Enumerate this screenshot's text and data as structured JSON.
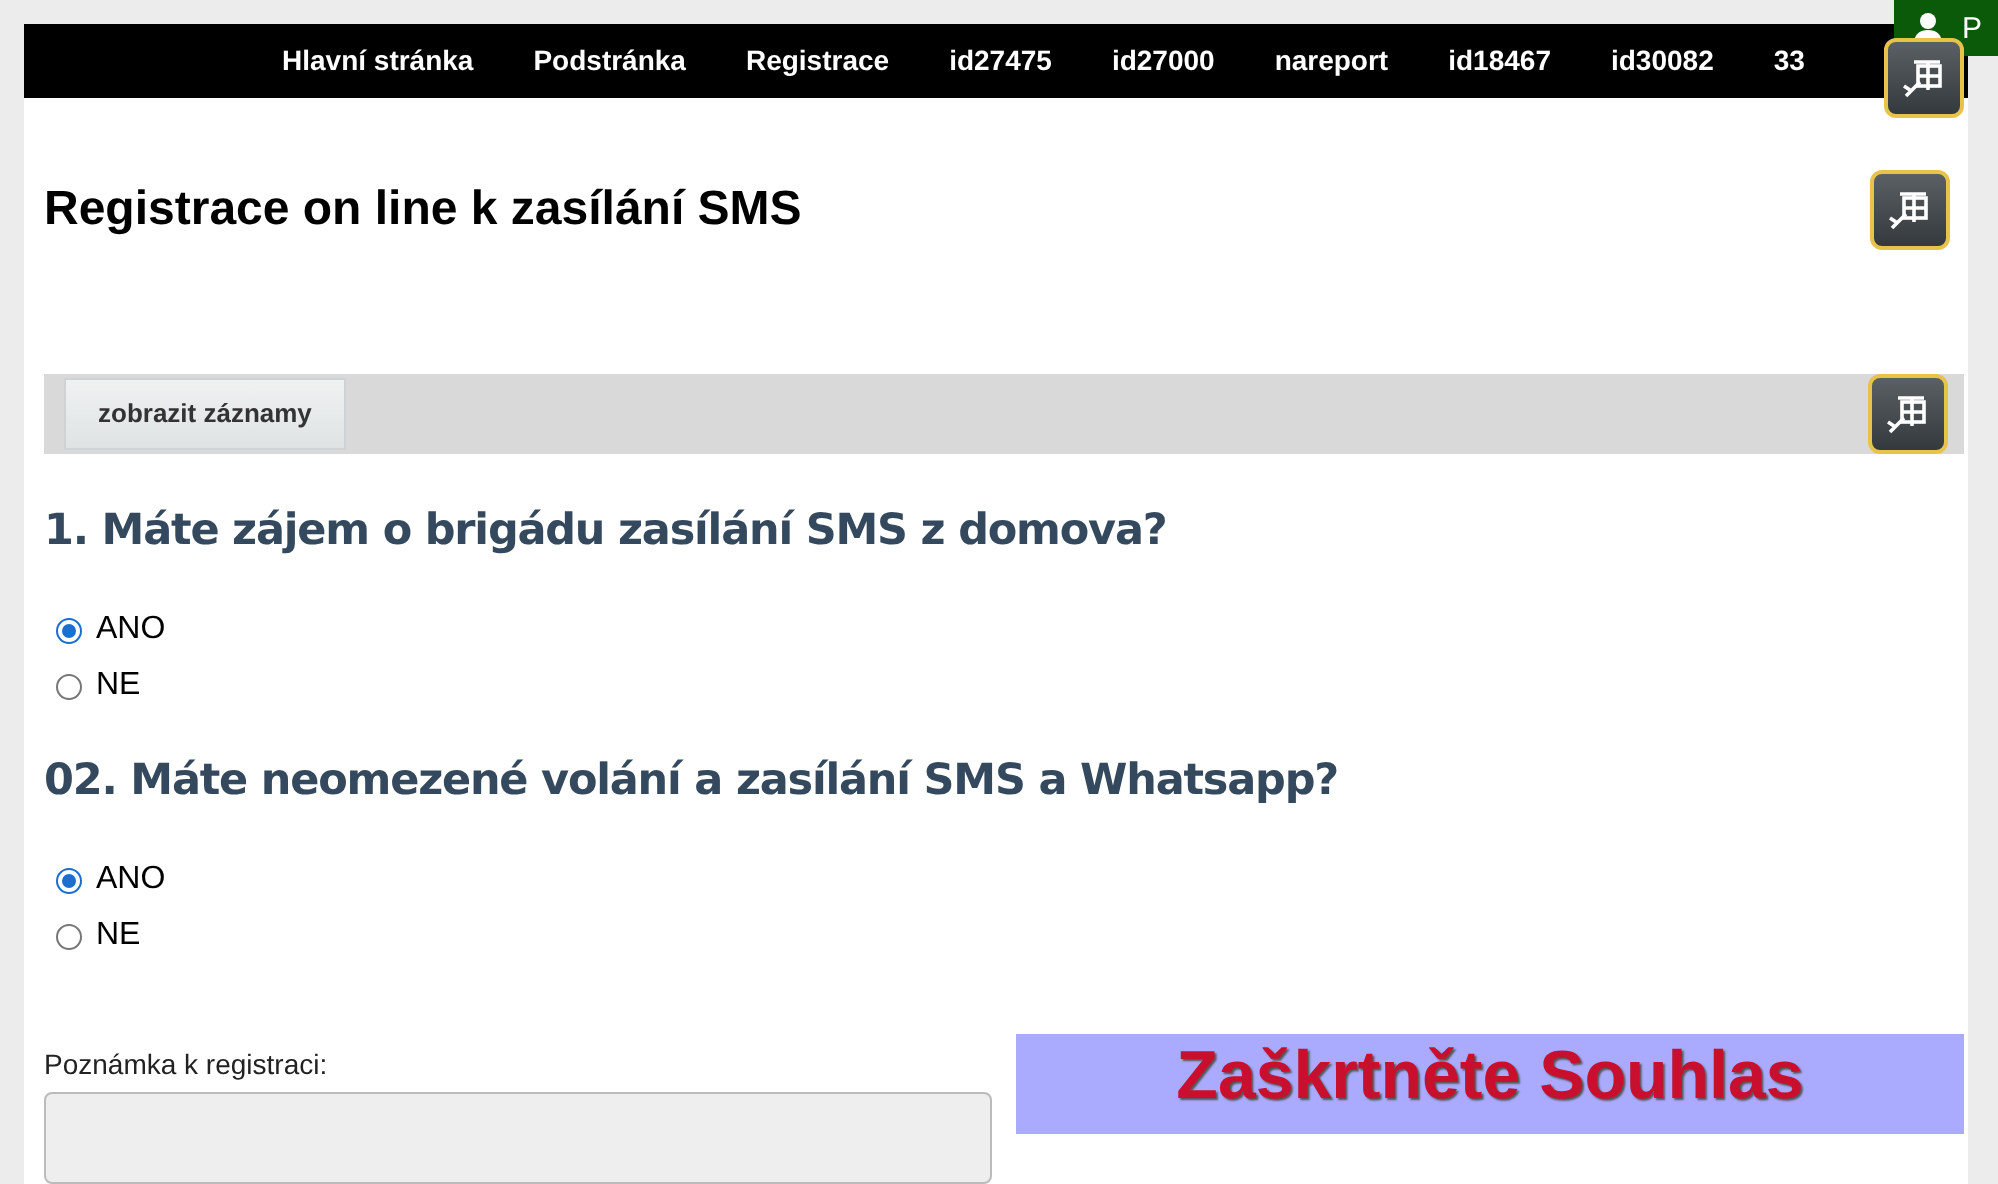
{
  "nav": {
    "items": [
      {
        "label": "Hlavní stránka"
      },
      {
        "label": "Podstránka"
      },
      {
        "label": "Registrace"
      },
      {
        "label": "id27475"
      },
      {
        "label": "id27000"
      },
      {
        "label": "nareport"
      },
      {
        "label": "id18467"
      },
      {
        "label": "id30082"
      },
      {
        "label": "33"
      }
    ]
  },
  "user_badge": {
    "label": "P"
  },
  "page_title": "Registrace on line k zasílání SMS",
  "toolbar": {
    "button": "zobrazit záznamy"
  },
  "questions": [
    {
      "title": "1. Máte zájem o brigádu zasílání SMS z domova?",
      "options": [
        {
          "label": "ANO",
          "selected": true
        },
        {
          "label": "NE",
          "selected": false
        }
      ]
    },
    {
      "title": "02. Máte neomezené volání a zasílání SMS a Whatsapp?",
      "options": [
        {
          "label": "ANO",
          "selected": true
        },
        {
          "label": "NE",
          "selected": false
        }
      ]
    }
  ],
  "note": {
    "label": "Poznámka k registraci:"
  },
  "banner": {
    "text": "Zaškrtněte Souhlas"
  }
}
